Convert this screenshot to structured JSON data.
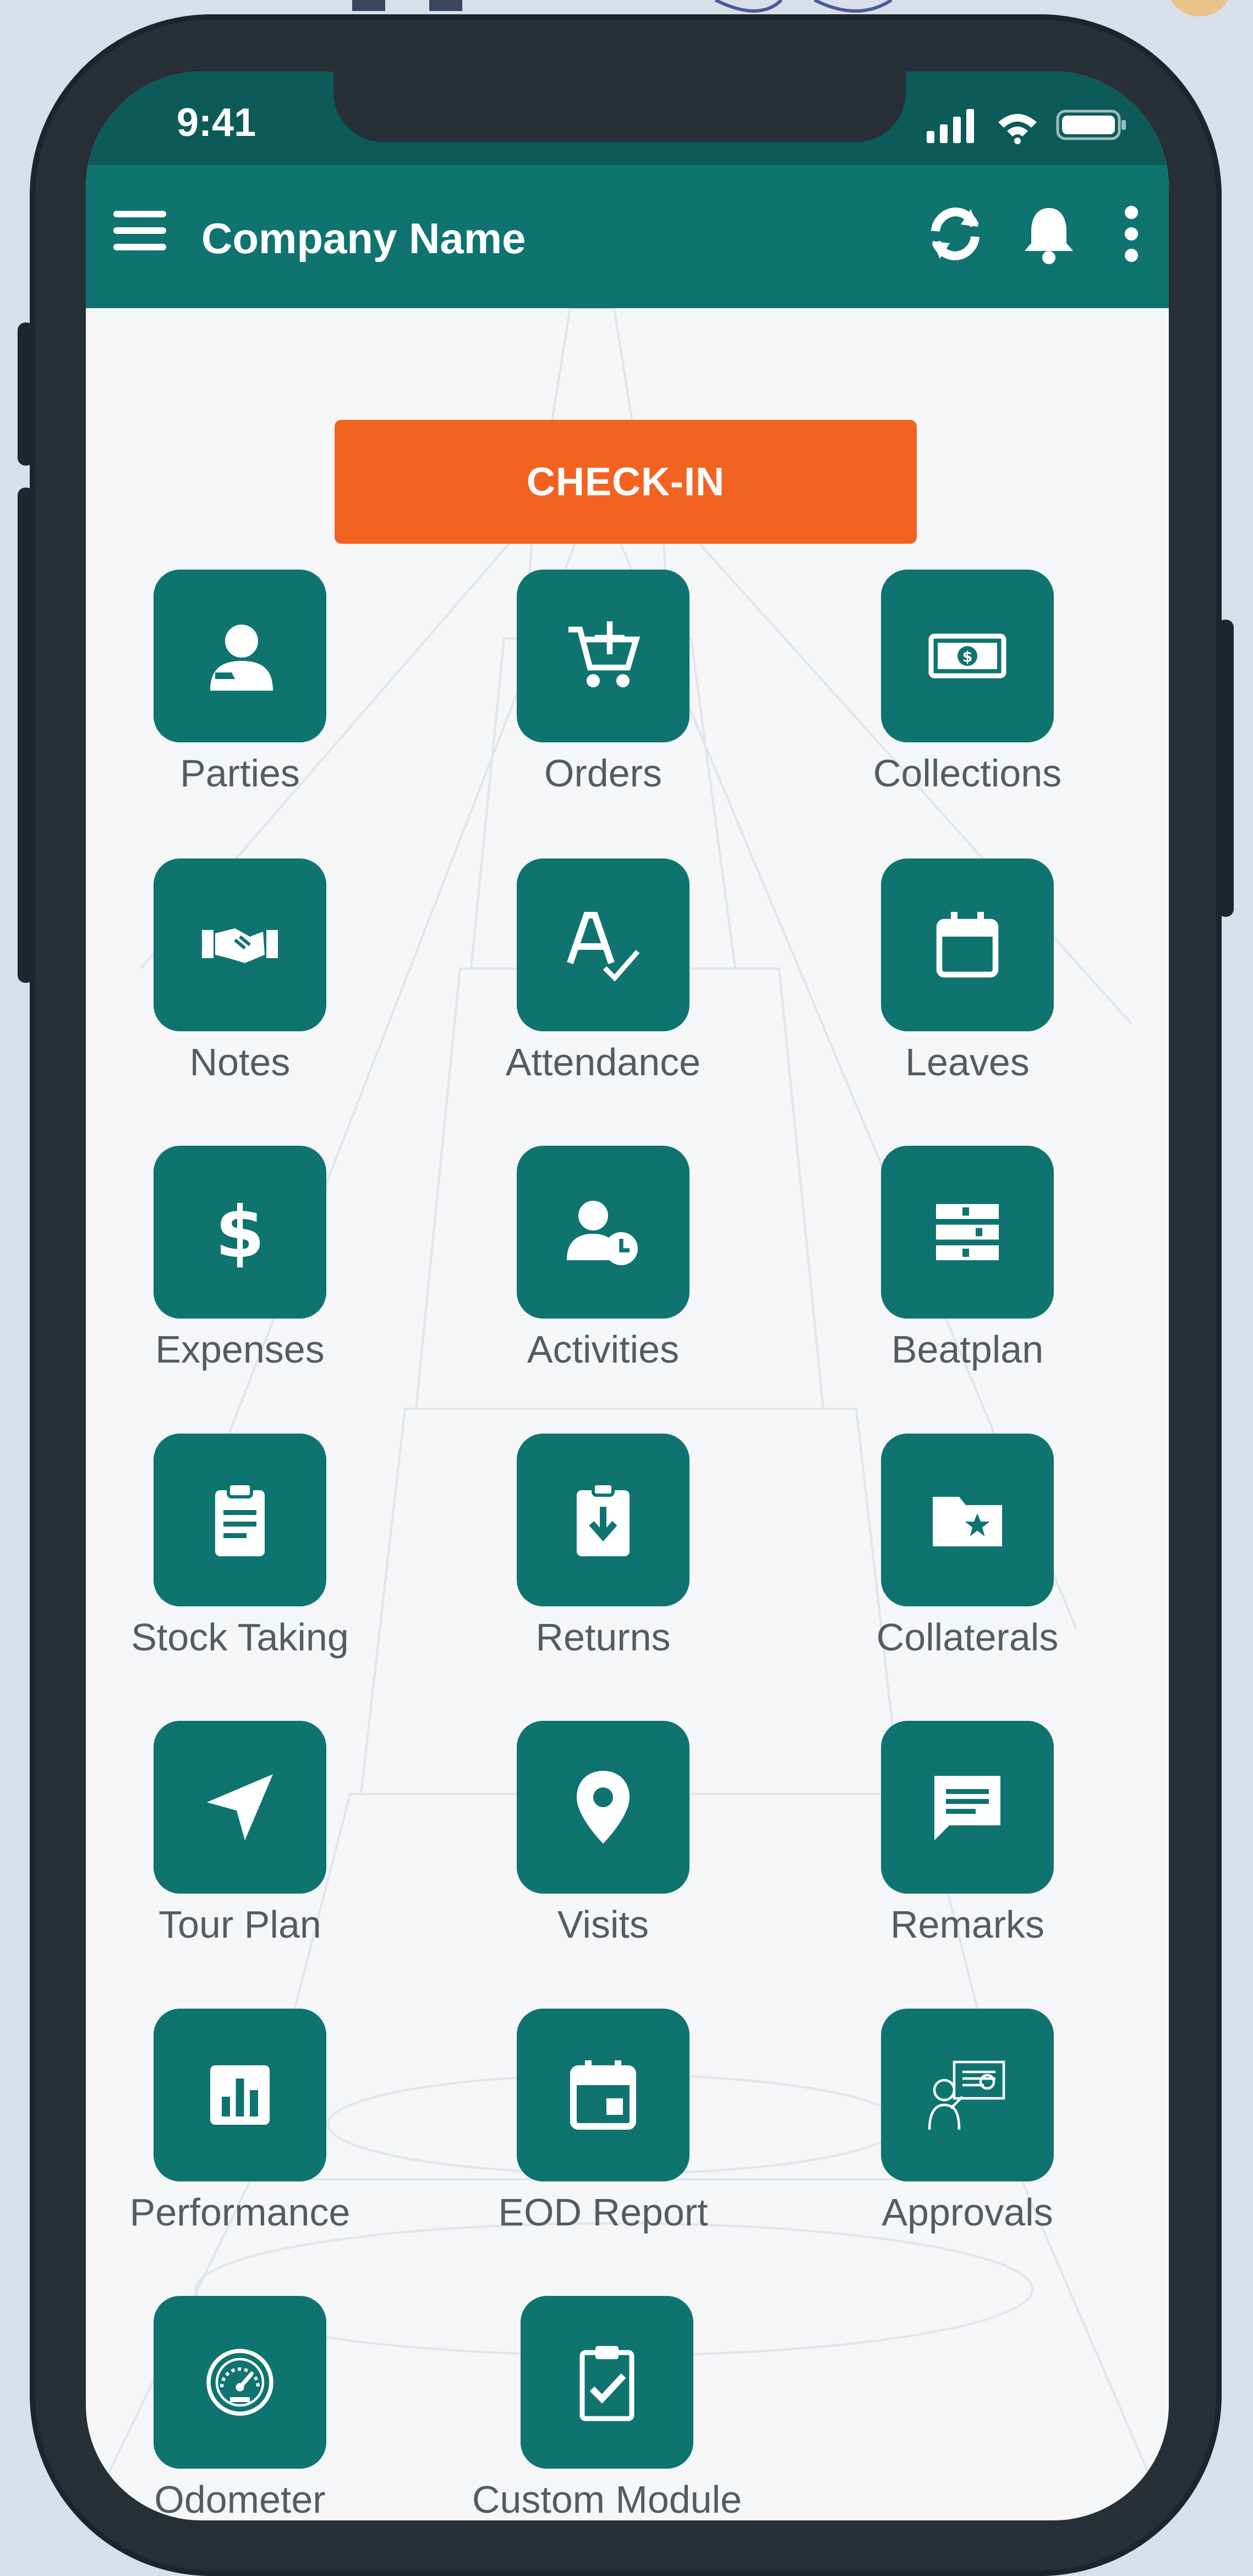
{
  "status_bar": {
    "time": "9:41"
  },
  "app_bar": {
    "title": "Company Name",
    "icons": [
      "menu-icon",
      "refresh-icon",
      "bell-icon",
      "more-vert-icon"
    ]
  },
  "check_in": {
    "label": "CHECK-IN"
  },
  "modules": [
    {
      "label": "Parties",
      "icon": "person-icon"
    },
    {
      "label": "Orders",
      "icon": "cart-add-icon"
    },
    {
      "label": "Collections",
      "icon": "money-icon"
    },
    {
      "label": "Notes",
      "icon": "handshake-icon"
    },
    {
      "label": "Attendance",
      "icon": "spellcheck-icon"
    },
    {
      "label": "Leaves",
      "icon": "calendar-icon"
    },
    {
      "label": "Expenses",
      "icon": "dollar-icon"
    },
    {
      "label": "Activities",
      "icon": "user-clock-icon"
    },
    {
      "label": "Beatplan",
      "icon": "list-stack-icon"
    },
    {
      "label": "Stock Taking",
      "icon": "clipboard-icon"
    },
    {
      "label": "Returns",
      "icon": "download-box-icon"
    },
    {
      "label": "Collaterals",
      "icon": "star-folder-icon"
    },
    {
      "label": "Tour Plan",
      "icon": "navigation-arrow-icon"
    },
    {
      "label": "Visits",
      "icon": "location-pin-icon"
    },
    {
      "label": "Remarks",
      "icon": "chat-bubble-icon"
    },
    {
      "label": "Performance",
      "icon": "bar-chart-icon"
    },
    {
      "label": "EOD Report",
      "icon": "event-icon"
    },
    {
      "label": "Approvals",
      "icon": "approval-board-icon"
    },
    {
      "label": "Odometer",
      "icon": "speedometer-icon"
    },
    {
      "label": "Custom Module",
      "icon": "clipboard-check-icon"
    }
  ],
  "colors": {
    "primary": "#0f7470",
    "status_bar": "#0c5b58",
    "accent": "#f26322",
    "label": "#555b61"
  }
}
